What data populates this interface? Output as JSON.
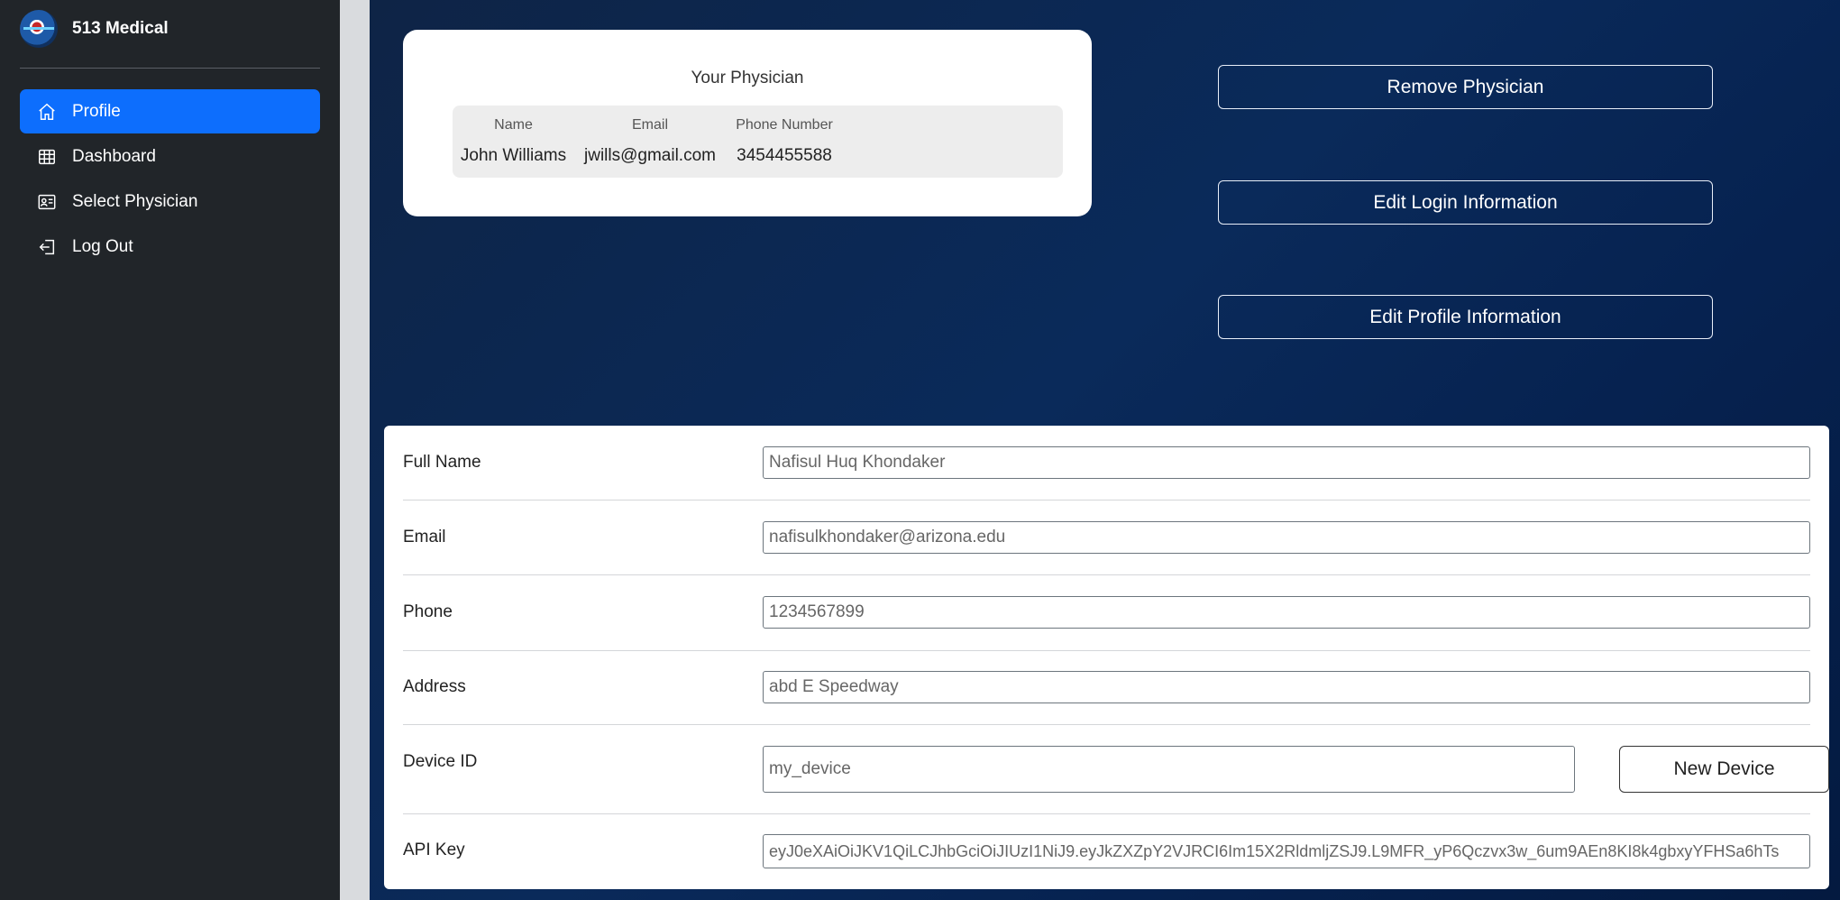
{
  "app": {
    "title": "513 Medical"
  },
  "sidebar": {
    "items": [
      {
        "label": "Profile",
        "icon": "home-icon",
        "active": true
      },
      {
        "label": "Dashboard",
        "icon": "table-icon",
        "active": false
      },
      {
        "label": "Select Physician",
        "icon": "person-card-icon",
        "active": false
      },
      {
        "label": "Log Out",
        "icon": "logout-icon",
        "active": false
      }
    ]
  },
  "physician_card": {
    "title": "Your Physician",
    "headers": {
      "name": "Name",
      "email": "Email",
      "phone": "Phone Number"
    },
    "values": {
      "name": "John Williams",
      "email": "jwills@gmail.com",
      "phone": "3454455588"
    }
  },
  "actions": {
    "remove": "Remove Physician",
    "edit_login": "Edit Login Information",
    "edit_profile": "Edit Profile Information"
  },
  "form": {
    "full_name": {
      "label": "Full Name",
      "value": "Nafisul Huq Khondaker"
    },
    "email": {
      "label": "Email",
      "value": "nafisulkhondaker@arizona.edu"
    },
    "phone": {
      "label": "Phone",
      "value": "1234567899"
    },
    "address": {
      "label": "Address",
      "value": "abd E Speedway"
    },
    "device_id": {
      "label": "Device ID",
      "value": "my_device",
      "button": "New Device"
    },
    "api_key": {
      "label": "API Key",
      "value": "eyJ0eXAiOiJKV1QiLCJhbGciOiJIUzI1NiJ9.eyJkZXZpY2VJRCI6Im15X2RldmljZSJ9.L9MFR_yP6Qczvx3w_6um9AEn8KI8k4gbxyYFHSa6hTs"
    }
  },
  "colors": {
    "sidebar_bg": "#212529",
    "accent": "#0d6efd",
    "main_bg": "#0a2a5a"
  }
}
